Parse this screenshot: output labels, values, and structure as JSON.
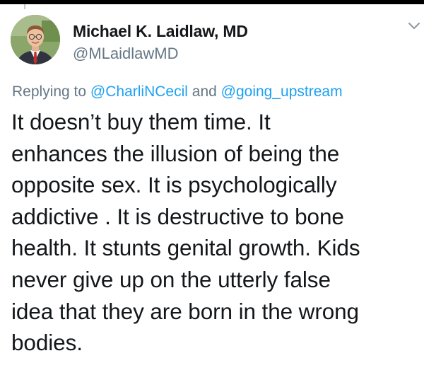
{
  "author": {
    "display_name": "Michael K. Laidlaw, MD",
    "handle": "@MLaidlawMD",
    "avatar_icon": "profile-photo"
  },
  "menu": {
    "icon": "chevron-down-icon"
  },
  "reply": {
    "prefix": "Replying to",
    "mention_1": "@CharliNCecil",
    "connector": "and",
    "mention_2": "@going_upstream"
  },
  "tweet": {
    "lines": [
      "It doesn’t buy them time. It",
      "enhances the illusion of being the",
      "opposite sex. It is psychologically",
      "addictive . It is destructive to bone",
      "health. It stunts genital growth. Kids",
      "never give up on the utterly false",
      "idea that they are born in the wrong",
      "bodies."
    ]
  },
  "colors": {
    "text": "#14171a",
    "secondary": "#657786",
    "link": "#1da1f2"
  }
}
